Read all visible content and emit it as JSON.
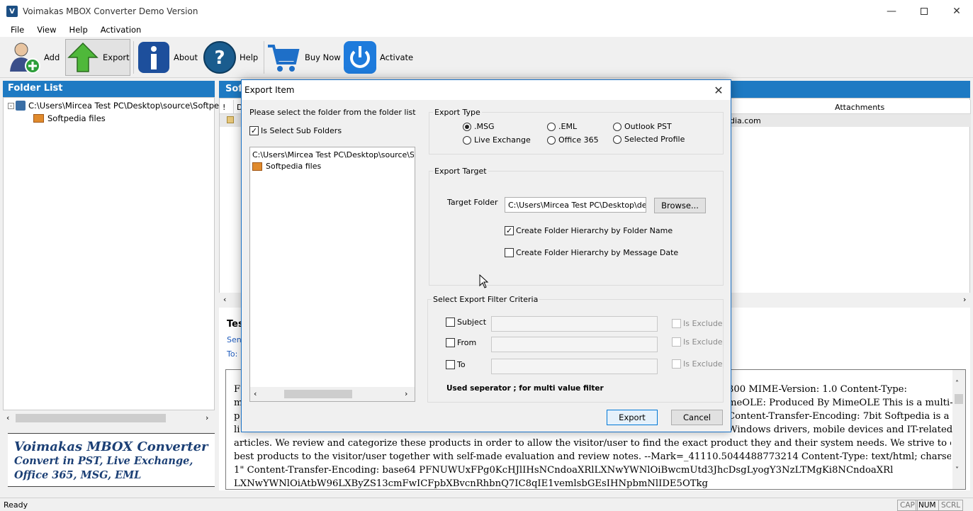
{
  "window": {
    "title": "Voimakas MBOX Converter Demo Version",
    "icon_letter": "V"
  },
  "menu": [
    "File",
    "View",
    "Help",
    "Activation"
  ],
  "toolbar": {
    "add": "Add",
    "export": "Export",
    "about": "About",
    "help": "Help",
    "buy_now": "Buy Now",
    "activate": "Activate"
  },
  "folder_panel": {
    "header": "Folder List",
    "root": "C:\\Users\\Mircea Test PC\\Desktop\\source\\Softpe",
    "child": "Softpedia files"
  },
  "brand": {
    "title": "Voimakas MBOX Converter",
    "line1": "Convert in PST, Live Exchange,",
    "line2": "Office 365, MSG, EML"
  },
  "right_panel": {
    "header": "Sof",
    "col_flag": "!",
    "col_d": "D",
    "col_attachments": "Attachments",
    "row_from_fragment": "dia.com",
    "preview_subject_fragment": "Tes",
    "preview_sent_label": "Sen",
    "preview_to_label": "To:",
    "body_left": [
      "F",
      "m",
      "p",
      "li"
    ],
    "body_right": [
      "300 MIME-Version: 1.0 Content-Type:",
      "meOLE: Produced By MimeOLE This is a multi-",
      "Content-Transfer-Encoding: 7bit Softpedia is a",
      "Windows drivers, mobile devices and IT-related"
    ],
    "body_lines": [
      "articles. We review and categorize these products in order to allow the visitor/user to find the exact product they and their system needs. We strive to deliver only the",
      "best products to the visitor/user together with self-made evaluation and review notes. --Mark=_41110.5044488773214 Content-Type: text/html; charset=\"iso-8859-",
      "1\" Content-Transfer-Encoding: base64 PFNUWUxFPg0KcHJlIHsNCndoaXRlLXNwYWNlOiBwcmUtd3JhcDsgLyogY3NzLTMgKi8NCndoaXRl",
      "LXNwYWNlOiAtbW96LXByZS13cmFwICFpbXBvcnRhbnQ7IC8qIE1vemlsbGEsIHNpbmNlIDE5OTkg"
    ]
  },
  "status": {
    "text": "Ready",
    "cap": "CAP",
    "num": "NUM",
    "scrl": "SCRL"
  },
  "dialog": {
    "title": "Export Item",
    "instruction": "Please select the folder from the folder list",
    "sub_folders": "Is Select Sub Folders",
    "tree_root": "C:\\Users\\Mircea Test PC\\Desktop\\source\\Softpe",
    "tree_child": "Softpedia files",
    "export_type_label": "Export Type",
    "types": [
      ".MSG",
      ".EML",
      "Outlook PST",
      "Live Exchange",
      "Office 365",
      "Selected Profile"
    ],
    "selected_type": ".MSG",
    "export_target_label": "Export Target",
    "target_folder_label": "Target Folder",
    "target_folder_value": "C:\\Users\\Mircea Test PC\\Desktop\\destin",
    "browse": "Browse...",
    "hierarchy_folder": "Create Folder Hierarchy by Folder Name",
    "hierarchy_date": "Create Folder Hierarchy by Message Date",
    "filter_label": "Select Export Filter Criteria",
    "filter_subject": "Subject",
    "filter_from": "From",
    "filter_to": "To",
    "is_exclude": "Is Exclude",
    "separator_note": "Used seperator ; for multi value filter",
    "export_btn": "Export",
    "cancel_btn": "Cancel"
  }
}
